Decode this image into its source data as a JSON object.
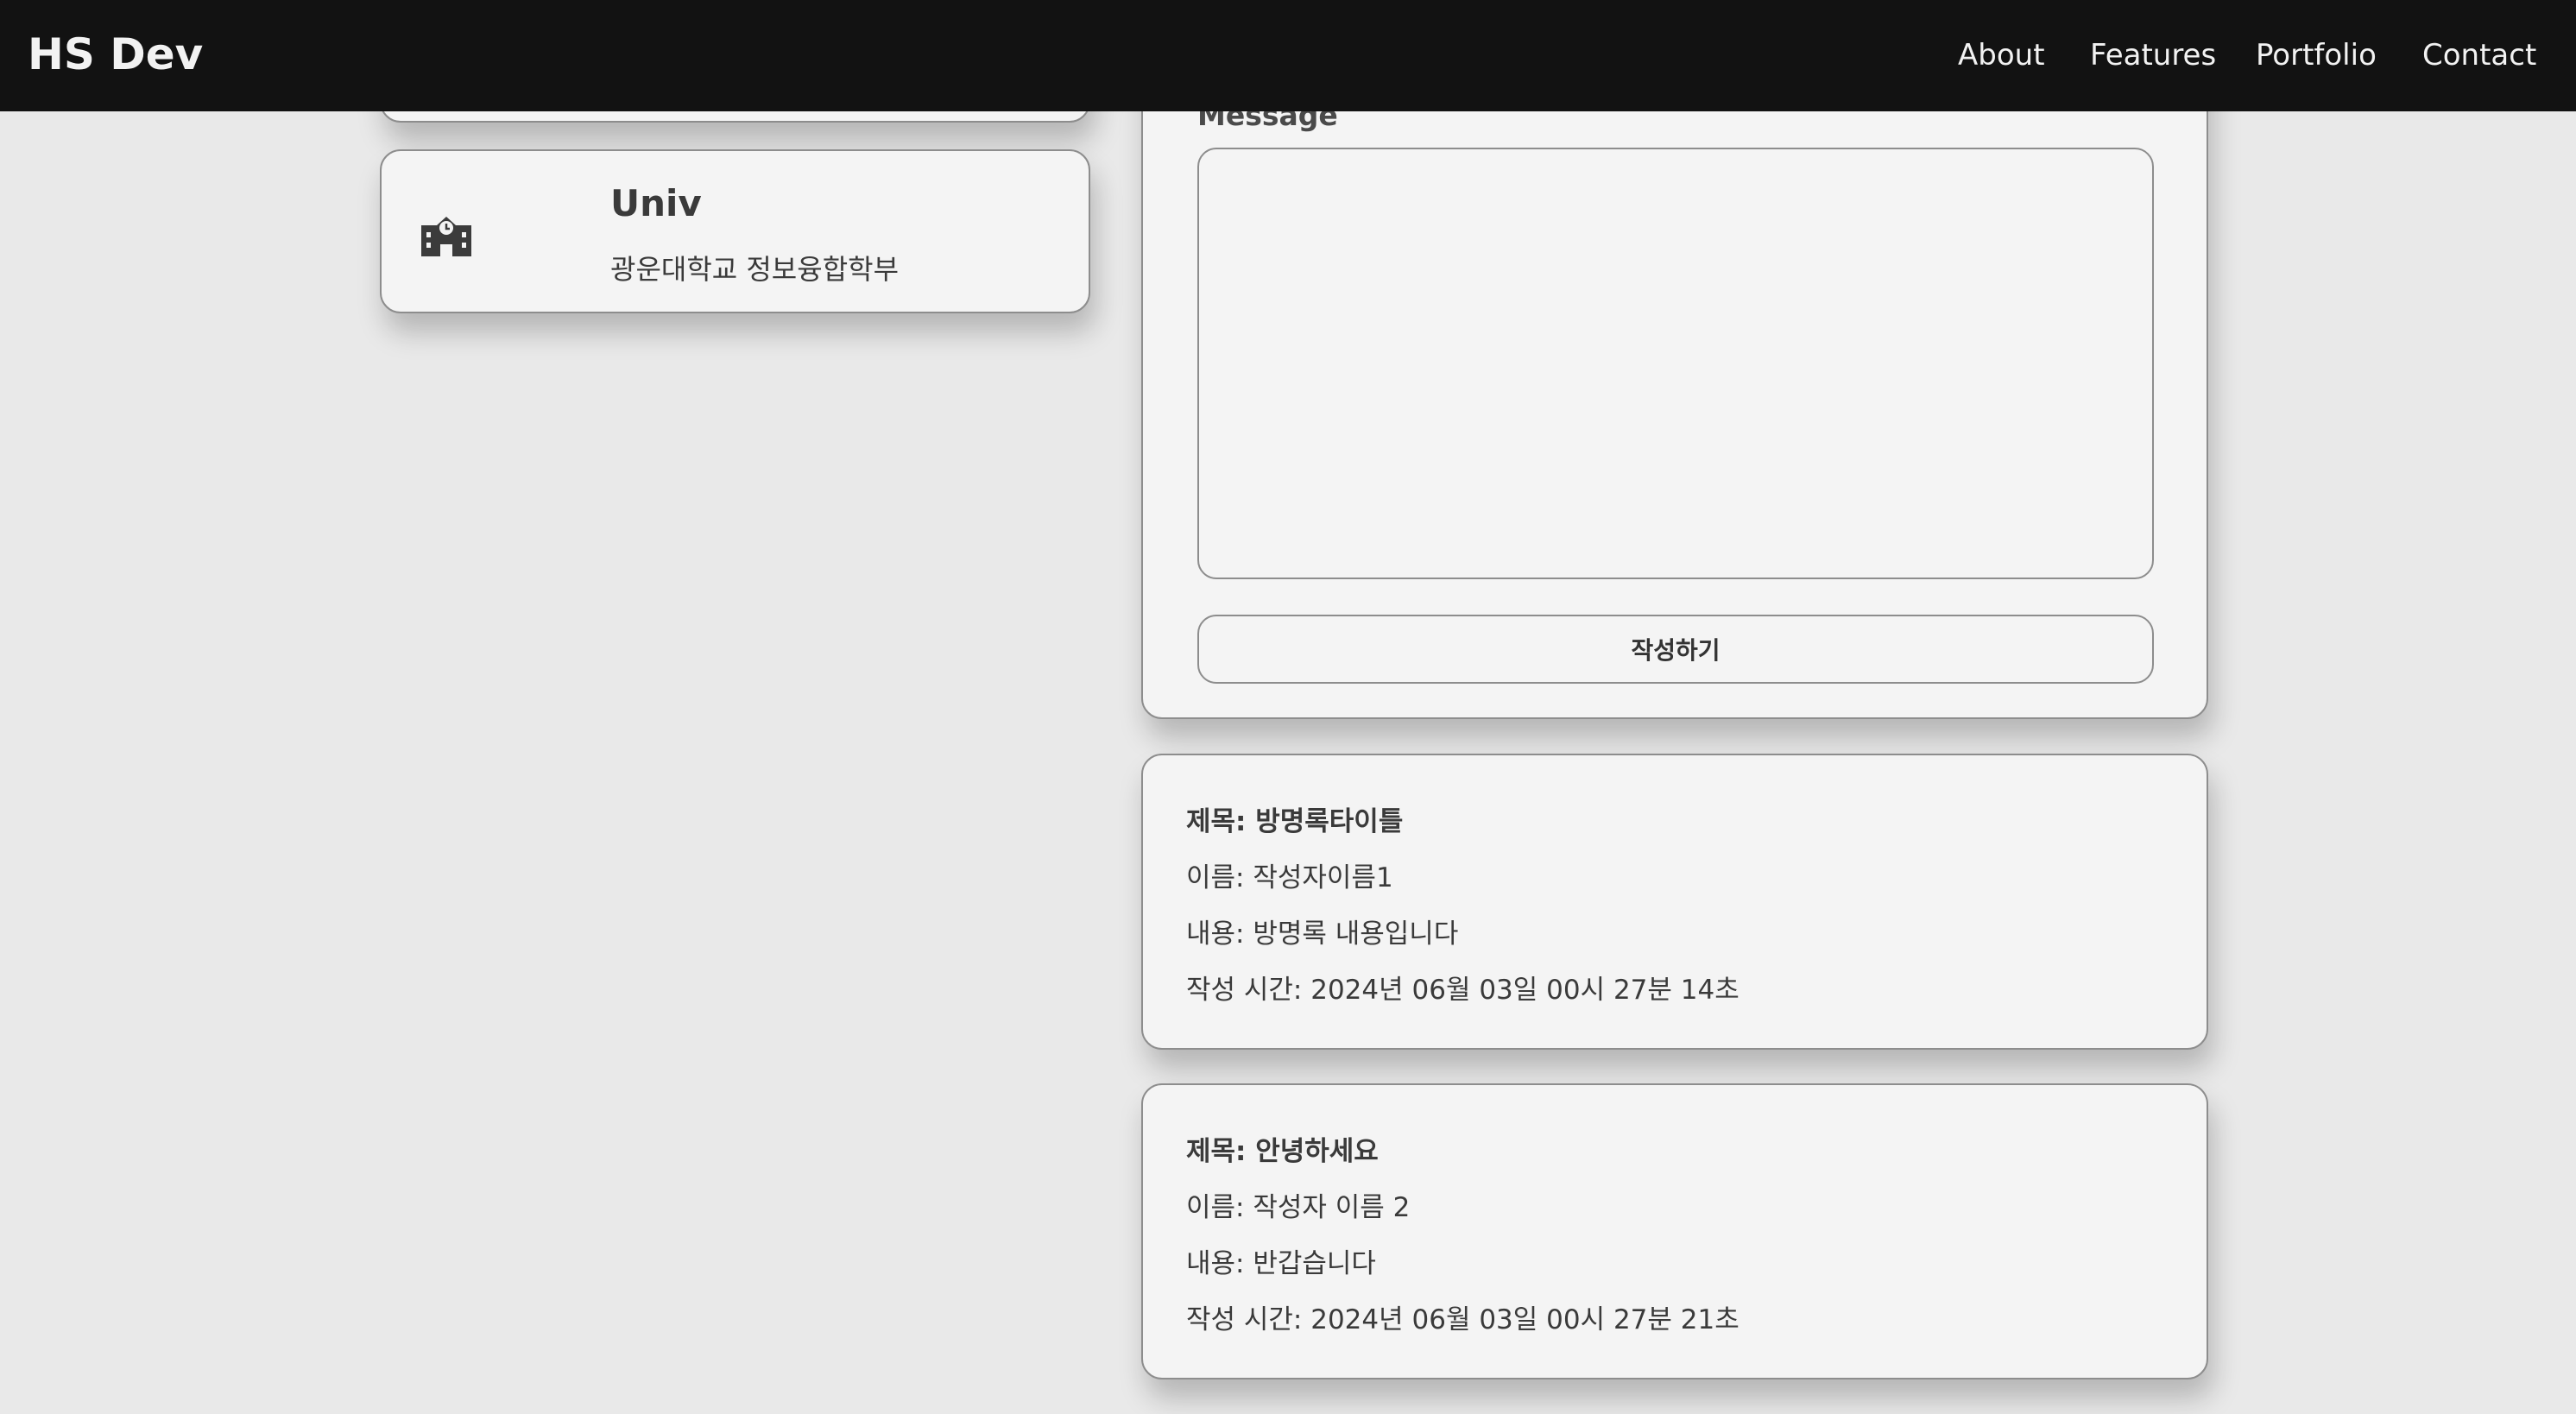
{
  "navbar": {
    "brand": "HS Dev",
    "links": [
      "About",
      "Features",
      "Portfolio",
      "Contact"
    ]
  },
  "profile": {
    "univ_card": {
      "icon": "school-icon",
      "title": "Univ",
      "subtitle": "광운대학교 정보융합학부"
    }
  },
  "guestbook_form": {
    "message_label": "Message",
    "message_value": "",
    "submit_label": "작성하기"
  },
  "guestbook_entries": [
    {
      "title": "제목: 방명록타이틀",
      "name": "이름: 작성자이름1",
      "content": "내용: 방명록 내용입니다",
      "time": "작성 시간: 2024년 06월 03일 00시 27분 14초"
    },
    {
      "title": "제목: 안녕하세요",
      "name": "이름: 작성자 이름 2",
      "content": "내용: 반갑습니다",
      "time": "작성 시간: 2024년 06월 03일 00시 27분 21초"
    }
  ],
  "colors": {
    "navbar_bg": "#121212",
    "page_bg": "#e9e9e9",
    "card_bg": "#f4f4f4",
    "border": "#8d8d8d"
  }
}
